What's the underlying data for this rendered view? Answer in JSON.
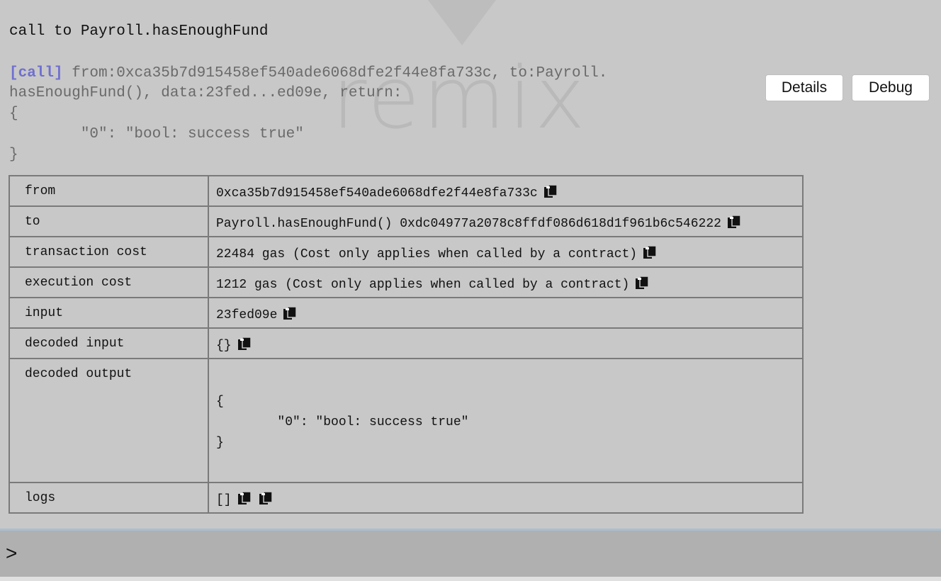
{
  "watermark": "remix",
  "call_title": "call to Payroll.hasEnoughFund",
  "log": {
    "tag": "[call]",
    "line1": " from:0xca35b7d915458ef540ade6068dfe2f44e8fa733c, to:Payroll.",
    "line2": "hasEnoughFund(), data:23fed...ed09e, return:",
    "line3": "{",
    "line4": "        \"0\": \"bool: success true\"",
    "line5": "}"
  },
  "buttons": {
    "details": "Details",
    "debug": "Debug"
  },
  "table": {
    "rows": [
      {
        "key": "from",
        "value": "0xca35b7d915458ef540ade6068dfe2f44e8fa733c"
      },
      {
        "key": "to",
        "value": "Payroll.hasEnoughFund() 0xdc04977a2078c8ffdf086d618d1f961b6c546222"
      },
      {
        "key": "transaction cost",
        "value": "22484 gas (Cost only applies when called by a contract)"
      },
      {
        "key": "execution cost",
        "value": "1212 gas (Cost only applies when called by a contract)"
      },
      {
        "key": "input",
        "value": "23fed09e"
      },
      {
        "key": "decoded input",
        "value": "{}"
      },
      {
        "key": "decoded output",
        "value_lines": [
          "{",
          "        \"0\": \"bool: success true\"",
          "}"
        ]
      },
      {
        "key": "logs",
        "value": "[]"
      }
    ]
  },
  "console": {
    "prompt": ">"
  },
  "icons": {
    "copy": "clipboard-copy-icon"
  }
}
